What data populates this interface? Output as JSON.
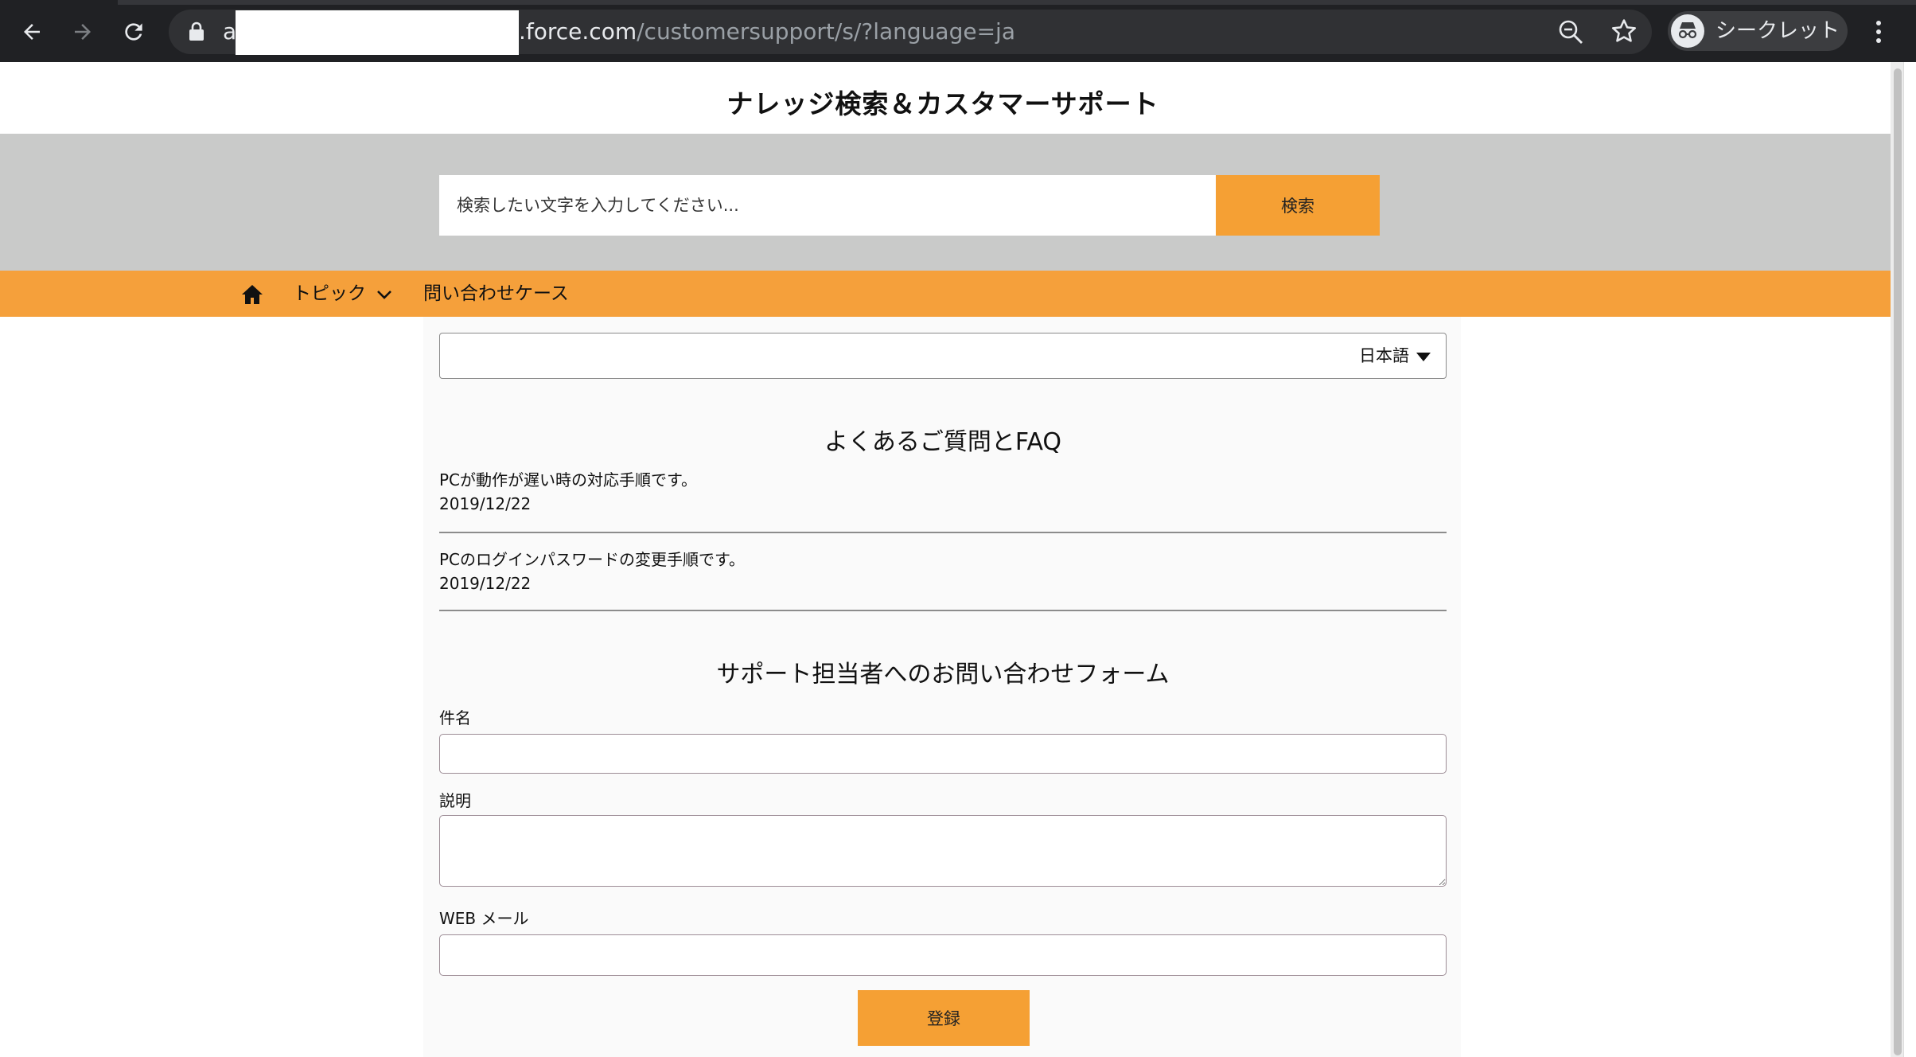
{
  "browser": {
    "url_host_fragment": "a",
    "url_domain": ".force.com",
    "url_path": "/customersupport/s/?language=ja",
    "incognito_label": "シークレット"
  },
  "page": {
    "title": "ナレッジ検索＆カスタマーサポート"
  },
  "search": {
    "placeholder": "検索したい文字を入力してください...",
    "button_label": "検索"
  },
  "nav": {
    "topics_label": "トピック",
    "cases_label": "問い合わせケース"
  },
  "language": {
    "selected": "日本語"
  },
  "faq": {
    "title": "よくあるご質問とFAQ",
    "items": [
      {
        "title": "PCが動作が遅い時の対応手順です。",
        "date": "2019/12/22"
      },
      {
        "title": "PCのログインパスワードの変更手順です。",
        "date": "2019/12/22"
      }
    ]
  },
  "form": {
    "title": "サポート担当者へのお問い合わせフォーム",
    "subject_label": "件名",
    "description_label": "説明",
    "email_label": "WEB メール",
    "submit_label": "登録"
  },
  "colors": {
    "accent_orange": "#f5a034",
    "search_band_gray": "#c9cac9",
    "chrome_dark": "#202124"
  }
}
